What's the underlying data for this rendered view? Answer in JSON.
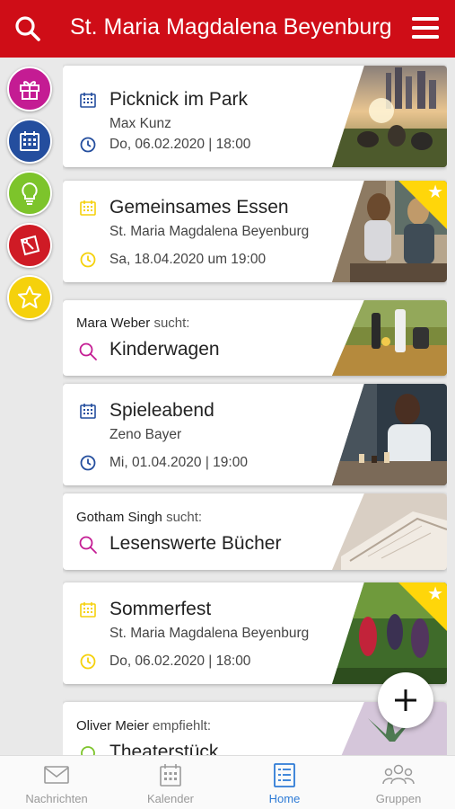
{
  "header": {
    "title": "St. Maria Magdalena Beyenburg",
    "color": "#cf0d17"
  },
  "categories": [
    {
      "name": "gift",
      "color": "#c41c93"
    },
    {
      "name": "calendar",
      "color": "#244e9e"
    },
    {
      "name": "lightbulb",
      "color": "#7dc42b"
    },
    {
      "name": "flyer",
      "color": "#cf1b25"
    },
    {
      "name": "star",
      "color": "#f5d10c"
    }
  ],
  "cards": [
    {
      "type": "event",
      "title": "Picknick im Park",
      "subtitle": "Max Kunz",
      "date": "Do, 06.02.2020 | 18:00",
      "icon_color": "#244e9e",
      "featured": false
    },
    {
      "type": "event",
      "title": "Gemeinsames Essen",
      "subtitle": "St. Maria Magdalena Beyenburg",
      "date": "Sa, 18.04.2020 um 19:00",
      "icon_color": "#f5d10c",
      "featured": true
    },
    {
      "type": "seek",
      "person": "Mara Weber",
      "verb": "sucht:",
      "title": "Kinderwagen",
      "icon_color": "#c41c93"
    },
    {
      "type": "event",
      "title": "Spieleabend",
      "subtitle": "Zeno Bayer",
      "date": "Mi, 01.04.2020 | 19:00",
      "icon_color": "#244e9e",
      "featured": false
    },
    {
      "type": "seek",
      "person": "Gotham Singh",
      "verb": "sucht:",
      "title": "Lesenswerte Bücher",
      "icon_color": "#c41c93"
    },
    {
      "type": "event",
      "title": "Sommerfest",
      "subtitle": "St. Maria Magdalena Beyenburg",
      "date": "Do, 06.02.2020 | 18:00",
      "icon_color": "#f5d10c",
      "featured": true
    },
    {
      "type": "recommend",
      "person": "Oliver Meier",
      "verb": "empfiehlt:",
      "title": "Theaterstück",
      "icon_color": "#7dc42b"
    }
  ],
  "fab": {
    "icon": "plus-icon"
  },
  "bottom_nav": [
    {
      "label": "Nachrichten",
      "icon": "envelope-icon",
      "active": false
    },
    {
      "label": "Kalender",
      "icon": "calendar-icon",
      "active": false
    },
    {
      "label": "Home",
      "icon": "home-list-icon",
      "active": true
    },
    {
      "label": "Gruppen",
      "icon": "group-icon",
      "active": false
    }
  ]
}
